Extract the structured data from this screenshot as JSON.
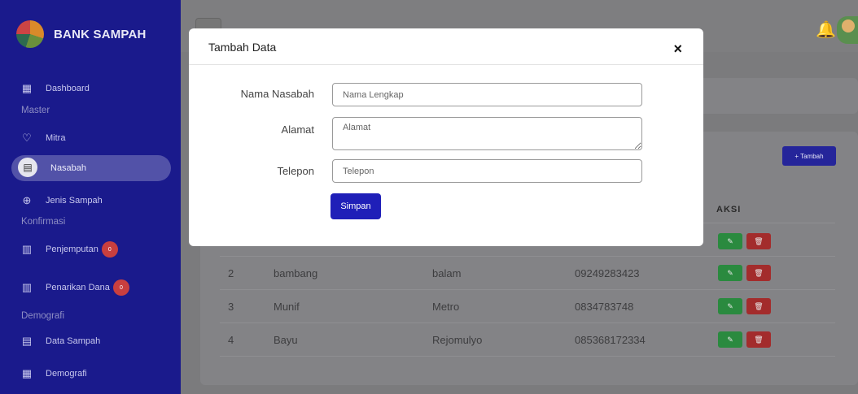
{
  "sidebar": {
    "brand": "BANK SAMPAH",
    "items": [
      {
        "label": "Dashboard",
        "icon": "dashboard-icon",
        "glyph": "▦"
      },
      {
        "label": "Mitra",
        "icon": "heart-icon",
        "glyph": "♡"
      },
      {
        "label": "Nasabah",
        "icon": "id-card-icon",
        "glyph": "▤"
      },
      {
        "label": "Jenis Sampah",
        "icon": "globe-icon",
        "glyph": "⊕"
      },
      {
        "label": "Penjemputan",
        "icon": "building-icon",
        "glyph": "▥",
        "badge": "0"
      },
      {
        "label": "Penarikan Dana",
        "icon": "building-icon",
        "glyph": "▥",
        "badge": "0"
      },
      {
        "label": "Data Sampah",
        "icon": "list-icon",
        "glyph": "▤"
      },
      {
        "label": "Demografi",
        "icon": "bank-icon",
        "glyph": "▦"
      }
    ],
    "sections": [
      "Master",
      "Konfirmasi",
      "Demografi"
    ]
  },
  "header": {
    "bell_icon": "bell-icon",
    "avatar": "user-avatar"
  },
  "main": {
    "add_button": "Tambah",
    "column_action": "AKSI",
    "rows": [
      {
        "no": "2",
        "nama": "bambang",
        "alamat": "balam",
        "telepon": "09249283423"
      },
      {
        "no": "3",
        "nama": "Munif",
        "alamat": "Metro",
        "telepon": "0834783748"
      },
      {
        "no": "4",
        "nama": "Bayu",
        "alamat": "Rejomulyo",
        "telepon": "085368172334"
      }
    ]
  },
  "modal": {
    "title": "Tambah Data",
    "close": "×",
    "fields": [
      {
        "label": "Nama Nasabah",
        "placeholder": "Nama Lengkap",
        "value": ""
      },
      {
        "label": "Alamat",
        "placeholder": "Alamat",
        "value": ""
      },
      {
        "label": "Telepon",
        "placeholder": "Telepon",
        "value": ""
      }
    ],
    "submit": "Simpan"
  },
  "colors": {
    "sidebar": "#1a1a8c",
    "primary": "#1f1fb8",
    "edit": "#2a8a3f",
    "delete": "#a32c2c",
    "badge": "#c93f3f"
  }
}
